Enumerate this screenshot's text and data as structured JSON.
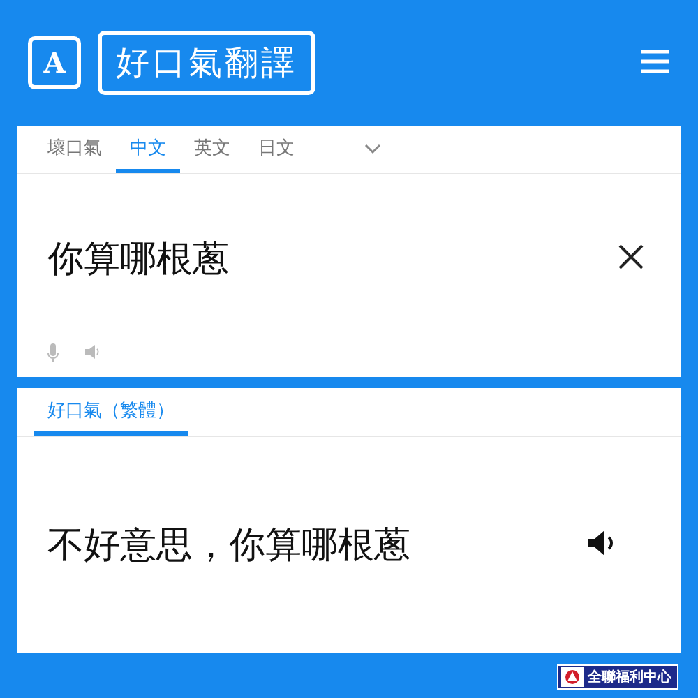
{
  "header": {
    "logo_letter": "A",
    "title": "好口氣翻譯"
  },
  "source": {
    "tabs": [
      {
        "label": "壞口氣",
        "selected": false
      },
      {
        "label": "中文",
        "selected": true
      },
      {
        "label": "英文",
        "selected": false
      },
      {
        "label": "日文",
        "selected": false
      }
    ],
    "input": "你算哪根蔥"
  },
  "result": {
    "tabs": [
      {
        "label": "好口氣（繁體）",
        "selected": true
      }
    ],
    "output": "不好意思，你算哪根蔥"
  },
  "footer": {
    "badge": "全聯福利中心"
  }
}
